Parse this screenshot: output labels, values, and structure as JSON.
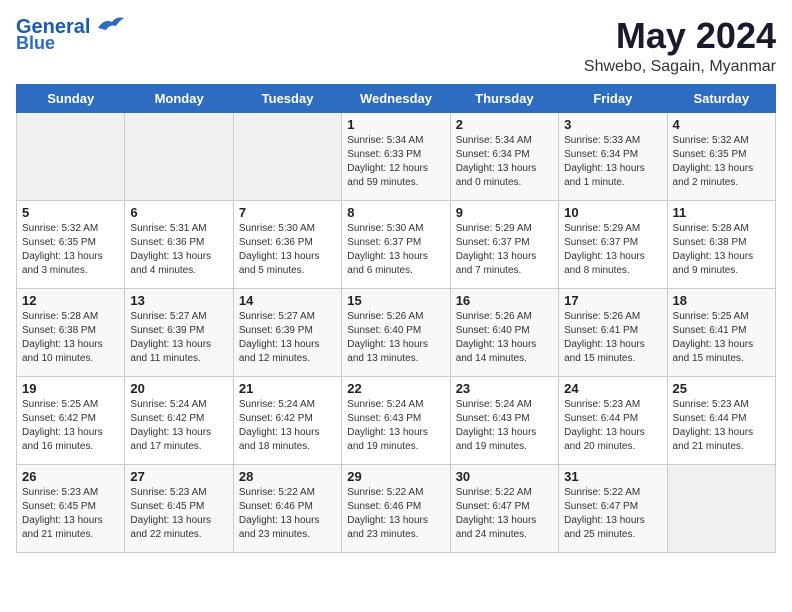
{
  "logo": {
    "line1": "General",
    "line2": "Blue"
  },
  "title": {
    "month_year": "May 2024",
    "location": "Shwebo, Sagain, Myanmar"
  },
  "weekdays": [
    "Sunday",
    "Monday",
    "Tuesday",
    "Wednesday",
    "Thursday",
    "Friday",
    "Saturday"
  ],
  "weeks": [
    [
      {
        "day": "",
        "info": ""
      },
      {
        "day": "",
        "info": ""
      },
      {
        "day": "",
        "info": ""
      },
      {
        "day": "1",
        "info": "Sunrise: 5:34 AM\nSunset: 6:33 PM\nDaylight: 12 hours\nand 59 minutes."
      },
      {
        "day": "2",
        "info": "Sunrise: 5:34 AM\nSunset: 6:34 PM\nDaylight: 13 hours\nand 0 minutes."
      },
      {
        "day": "3",
        "info": "Sunrise: 5:33 AM\nSunset: 6:34 PM\nDaylight: 13 hours\nand 1 minute."
      },
      {
        "day": "4",
        "info": "Sunrise: 5:32 AM\nSunset: 6:35 PM\nDaylight: 13 hours\nand 2 minutes."
      }
    ],
    [
      {
        "day": "5",
        "info": "Sunrise: 5:32 AM\nSunset: 6:35 PM\nDaylight: 13 hours\nand 3 minutes."
      },
      {
        "day": "6",
        "info": "Sunrise: 5:31 AM\nSunset: 6:36 PM\nDaylight: 13 hours\nand 4 minutes."
      },
      {
        "day": "7",
        "info": "Sunrise: 5:30 AM\nSunset: 6:36 PM\nDaylight: 13 hours\nand 5 minutes."
      },
      {
        "day": "8",
        "info": "Sunrise: 5:30 AM\nSunset: 6:37 PM\nDaylight: 13 hours\nand 6 minutes."
      },
      {
        "day": "9",
        "info": "Sunrise: 5:29 AM\nSunset: 6:37 PM\nDaylight: 13 hours\nand 7 minutes."
      },
      {
        "day": "10",
        "info": "Sunrise: 5:29 AM\nSunset: 6:37 PM\nDaylight: 13 hours\nand 8 minutes."
      },
      {
        "day": "11",
        "info": "Sunrise: 5:28 AM\nSunset: 6:38 PM\nDaylight: 13 hours\nand 9 minutes."
      }
    ],
    [
      {
        "day": "12",
        "info": "Sunrise: 5:28 AM\nSunset: 6:38 PM\nDaylight: 13 hours\nand 10 minutes."
      },
      {
        "day": "13",
        "info": "Sunrise: 5:27 AM\nSunset: 6:39 PM\nDaylight: 13 hours\nand 11 minutes."
      },
      {
        "day": "14",
        "info": "Sunrise: 5:27 AM\nSunset: 6:39 PM\nDaylight: 13 hours\nand 12 minutes."
      },
      {
        "day": "15",
        "info": "Sunrise: 5:26 AM\nSunset: 6:40 PM\nDaylight: 13 hours\nand 13 minutes."
      },
      {
        "day": "16",
        "info": "Sunrise: 5:26 AM\nSunset: 6:40 PM\nDaylight: 13 hours\nand 14 minutes."
      },
      {
        "day": "17",
        "info": "Sunrise: 5:26 AM\nSunset: 6:41 PM\nDaylight: 13 hours\nand 15 minutes."
      },
      {
        "day": "18",
        "info": "Sunrise: 5:25 AM\nSunset: 6:41 PM\nDaylight: 13 hours\nand 15 minutes."
      }
    ],
    [
      {
        "day": "19",
        "info": "Sunrise: 5:25 AM\nSunset: 6:42 PM\nDaylight: 13 hours\nand 16 minutes."
      },
      {
        "day": "20",
        "info": "Sunrise: 5:24 AM\nSunset: 6:42 PM\nDaylight: 13 hours\nand 17 minutes."
      },
      {
        "day": "21",
        "info": "Sunrise: 5:24 AM\nSunset: 6:42 PM\nDaylight: 13 hours\nand 18 minutes."
      },
      {
        "day": "22",
        "info": "Sunrise: 5:24 AM\nSunset: 6:43 PM\nDaylight: 13 hours\nand 19 minutes."
      },
      {
        "day": "23",
        "info": "Sunrise: 5:24 AM\nSunset: 6:43 PM\nDaylight: 13 hours\nand 19 minutes."
      },
      {
        "day": "24",
        "info": "Sunrise: 5:23 AM\nSunset: 6:44 PM\nDaylight: 13 hours\nand 20 minutes."
      },
      {
        "day": "25",
        "info": "Sunrise: 5:23 AM\nSunset: 6:44 PM\nDaylight: 13 hours\nand 21 minutes."
      }
    ],
    [
      {
        "day": "26",
        "info": "Sunrise: 5:23 AM\nSunset: 6:45 PM\nDaylight: 13 hours\nand 21 minutes."
      },
      {
        "day": "27",
        "info": "Sunrise: 5:23 AM\nSunset: 6:45 PM\nDaylight: 13 hours\nand 22 minutes."
      },
      {
        "day": "28",
        "info": "Sunrise: 5:22 AM\nSunset: 6:46 PM\nDaylight: 13 hours\nand 23 minutes."
      },
      {
        "day": "29",
        "info": "Sunrise: 5:22 AM\nSunset: 6:46 PM\nDaylight: 13 hours\nand 23 minutes."
      },
      {
        "day": "30",
        "info": "Sunrise: 5:22 AM\nSunset: 6:47 PM\nDaylight: 13 hours\nand 24 minutes."
      },
      {
        "day": "31",
        "info": "Sunrise: 5:22 AM\nSunset: 6:47 PM\nDaylight: 13 hours\nand 25 minutes."
      },
      {
        "day": "",
        "info": ""
      }
    ]
  ]
}
